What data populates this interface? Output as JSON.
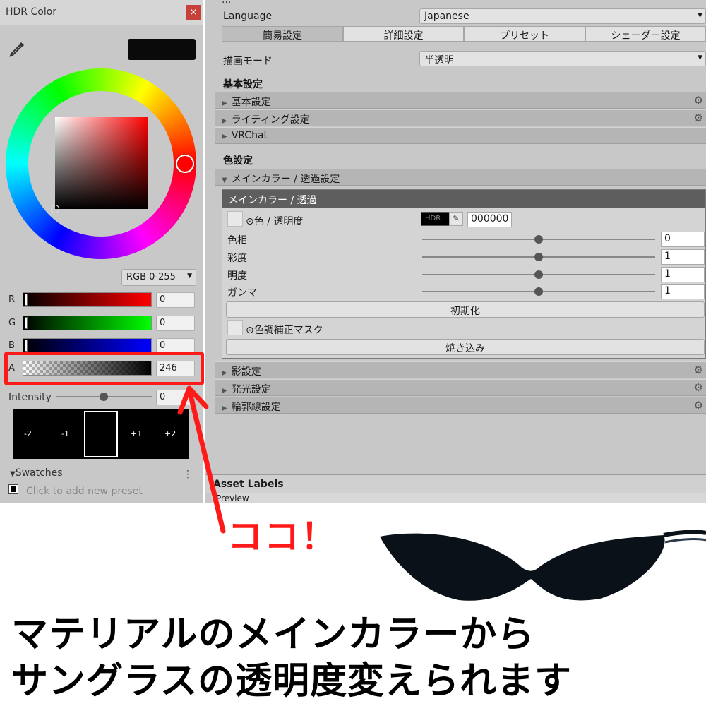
{
  "hdr_color": {
    "title": "HDR Color",
    "close_glyph": "×",
    "preview_color": "#0a0a0a",
    "mode": "RGB 0-255",
    "channels": [
      {
        "label": "R",
        "value": "0"
      },
      {
        "label": "G",
        "value": "0"
      },
      {
        "label": "B",
        "value": "0"
      },
      {
        "label": "A",
        "value": "246"
      }
    ],
    "intensity_label": "Intensity",
    "intensity_value": "0",
    "intensity_stops": [
      "-2",
      "-1",
      "+1",
      "+2"
    ],
    "swatches_label": "Swatches",
    "swatches_menu": "⋮",
    "add_preset_hint": "Click to add new preset"
  },
  "inspector": {
    "top_partial": "...",
    "language_label": "Language",
    "language_value": "Japanese",
    "tabs": [
      "簡易設定",
      "詳細設定",
      "プリセット",
      "シェーダー設定"
    ],
    "render_mode_label": "描画モード",
    "render_mode_value": "半透明",
    "basic_header": "基本設定",
    "basic_folds": [
      "基本設定",
      "ライティング設定",
      "VRChat"
    ],
    "color_header": "色設定",
    "main_color_fold": "メインカラー / 透過設定",
    "sub_header": "メインカラー / 透過",
    "color_alpha_label": "⊙色 / 透明度",
    "hdr_chip": "HDR",
    "hex_value": "000000",
    "adjust_rows": [
      {
        "label": "色相",
        "value": "0"
      },
      {
        "label": "彩度",
        "value": "1"
      },
      {
        "label": "明度",
        "value": "1"
      },
      {
        "label": "ガンマ",
        "value": "1"
      }
    ],
    "reset_button": "初期化",
    "mask_label": "⊙色調補正マスク",
    "bake_button": "焼き込み",
    "other_folds": [
      "影設定",
      "発光設定",
      "輪郭線設定"
    ],
    "asset_labels": "Asset Labels",
    "preview_label": "Preview"
  },
  "annotation": {
    "callout": "ココ！",
    "caption_line1": "マテリアルのメインカラーから",
    "caption_line2": "サングラスの透明度変えられます",
    "accent_color": "#ff1a1a"
  }
}
